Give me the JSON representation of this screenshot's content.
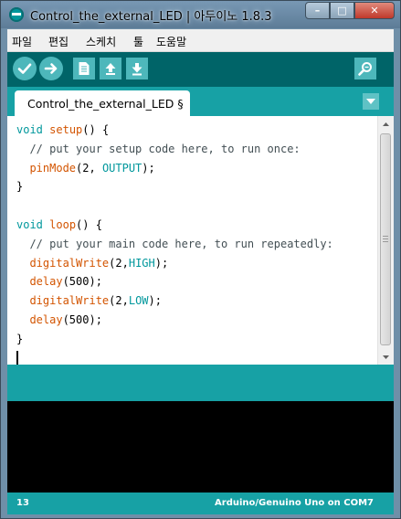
{
  "window": {
    "title": "Control_the_external_LED | 아두이노 1.8.3",
    "buttons": {
      "minimize": "–",
      "maximize": "□",
      "close": "✕"
    }
  },
  "menu": [
    "파일",
    "편집",
    "스케치",
    "툴",
    "도움말"
  ],
  "toolbar": {
    "verify": "check-icon",
    "upload": "arrow-right-icon",
    "new": "new-file-icon",
    "open": "open-up-arrow-icon",
    "save": "save-down-arrow-icon",
    "serial_monitor": "magnifier-icon"
  },
  "tab": {
    "label": "Control_the_external_LED §"
  },
  "code": {
    "line1_void": "void",
    "line1_fn": "setup",
    "line1_rest": "() {",
    "line2": "  // put your setup code here, to run once:",
    "line3_fn": "pinMode",
    "line3_open": "(2, ",
    "line3_const": "OUTPUT",
    "line3_close": ");",
    "line4": "}",
    "line6_void": "void",
    "line6_fn": "loop",
    "line6_rest": "() {",
    "line7": "  // put your main code here, to run repeatedly:",
    "line8_fn": "digitalWrite",
    "line8_open": "(2,",
    "line8_const": "HIGH",
    "line8_close": ");",
    "line9_fn": "delay",
    "line9_rest": "(500);",
    "line10_fn": "digitalWrite",
    "line10_open": "(2,",
    "line10_const": "LOW",
    "line10_close": ");",
    "line11_fn": "delay",
    "line11_rest": "(500);",
    "line12": "}"
  },
  "status": {
    "line_number": "13",
    "board": "Arduino/Genuino Uno on COM7"
  },
  "colors": {
    "toolbar_bg": "#006468",
    "tab_strip_bg": "#17a1a5",
    "keyword": "#00979c",
    "function": "#d35400",
    "console_bg": "#000000"
  }
}
